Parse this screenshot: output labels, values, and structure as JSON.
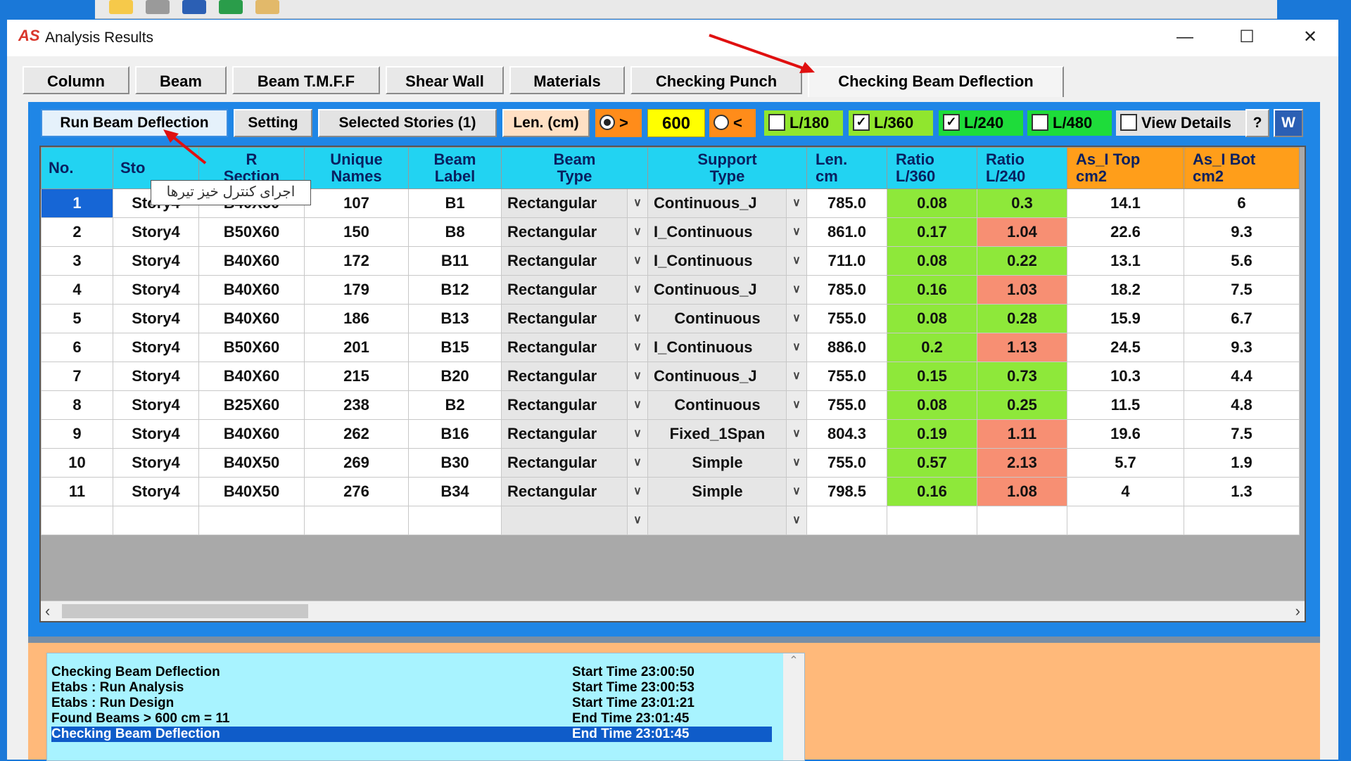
{
  "window": {
    "title": "Analysis Results",
    "app_icon": "AS"
  },
  "main_tabs": [
    "Column",
    "Beam",
    "Beam T.M.F.F",
    "Shear Wall",
    "Materials",
    "Checking Punch",
    "Checking Beam Deflection"
  ],
  "toolbar": {
    "run_label": "Run Beam Deflection",
    "setting_label": "Setting",
    "stories_label": "Selected Stories (1)",
    "len_label": "Len. (cm)",
    "gt_symbol": ">",
    "lt_symbol": "<",
    "len_value": "600",
    "chk_l180": "L/180",
    "chk_l360": "L/360",
    "chk_l240": "L/240",
    "chk_l480": "L/480",
    "view_details": "View Details",
    "help": "?",
    "word_icon": "W"
  },
  "tooltip": "اجرای کنترل خیز تیرها",
  "grid": {
    "headers": [
      "No.",
      "Story",
      "Section",
      "Unique Names",
      "Beam Label",
      "Beam Type",
      "Support Type",
      "Len. cm",
      "Ratio L/360",
      "Ratio L/240",
      "As_I Top cm2",
      "As_I Bot cm2"
    ],
    "header_lines": [
      [
        "No."
      ],
      [
        "Sto"
      ],
      [
        "R",
        "Section"
      ],
      [
        "Unique",
        "Names"
      ],
      [
        "Beam",
        "Label"
      ],
      [
        "Beam",
        "Type"
      ],
      [
        "Support",
        "Type"
      ],
      [
        "Len.",
        "cm"
      ],
      [
        "Ratio",
        "L/360"
      ],
      [
        "Ratio",
        "L/240"
      ],
      [
        "As_I Top",
        "cm2"
      ],
      [
        "As_I Bot",
        "cm2"
      ]
    ],
    "rows": [
      {
        "no": "1",
        "story": "Story4",
        "section": "B40X60",
        "unique": "107",
        "label": "B1",
        "type": "Rectangular",
        "support": "Continuous_J",
        "len": "785.0",
        "r360": "0.08",
        "r240": "0.3",
        "top": "14.1",
        "bot": "6",
        "r240_status": "ok"
      },
      {
        "no": "2",
        "story": "Story4",
        "section": "B50X60",
        "unique": "150",
        "label": "B8",
        "type": "Rectangular",
        "support": "I_Continuous",
        "len": "861.0",
        "r360": "0.17",
        "r240": "1.04",
        "top": "22.6",
        "bot": "9.3",
        "r240_status": "fail"
      },
      {
        "no": "3",
        "story": "Story4",
        "section": "B40X60",
        "unique": "172",
        "label": "B11",
        "type": "Rectangular",
        "support": "I_Continuous",
        "len": "711.0",
        "r360": "0.08",
        "r240": "0.22",
        "top": "13.1",
        "bot": "5.6",
        "r240_status": "ok"
      },
      {
        "no": "4",
        "story": "Story4",
        "section": "B40X60",
        "unique": "179",
        "label": "B12",
        "type": "Rectangular",
        "support": "Continuous_J",
        "len": "785.0",
        "r360": "0.16",
        "r240": "1.03",
        "top": "18.2",
        "bot": "7.5",
        "r240_status": "fail"
      },
      {
        "no": "5",
        "story": "Story4",
        "section": "B40X60",
        "unique": "186",
        "label": "B13",
        "type": "Rectangular",
        "support": "Continuous",
        "len": "755.0",
        "r360": "0.08",
        "r240": "0.28",
        "top": "15.9",
        "bot": "6.7",
        "r240_status": "ok"
      },
      {
        "no": "6",
        "story": "Story4",
        "section": "B50X60",
        "unique": "201",
        "label": "B15",
        "type": "Rectangular",
        "support": "I_Continuous",
        "len": "886.0",
        "r360": "0.2",
        "r240": "1.13",
        "top": "24.5",
        "bot": "9.3",
        "r240_status": "fail"
      },
      {
        "no": "7",
        "story": "Story4",
        "section": "B40X60",
        "unique": "215",
        "label": "B20",
        "type": "Rectangular",
        "support": "Continuous_J",
        "len": "755.0",
        "r360": "0.15",
        "r240": "0.73",
        "top": "10.3",
        "bot": "4.4",
        "r240_status": "ok"
      },
      {
        "no": "8",
        "story": "Story4",
        "section": "B25X60",
        "unique": "238",
        "label": "B2",
        "type": "Rectangular",
        "support": "Continuous",
        "len": "755.0",
        "r360": "0.08",
        "r240": "0.25",
        "top": "11.5",
        "bot": "4.8",
        "r240_status": "ok"
      },
      {
        "no": "9",
        "story": "Story4",
        "section": "B40X60",
        "unique": "262",
        "label": "B16",
        "type": "Rectangular",
        "support": "Fixed_1Span",
        "len": "804.3",
        "r360": "0.19",
        "r240": "1.11",
        "top": "19.6",
        "bot": "7.5",
        "r240_status": "fail"
      },
      {
        "no": "10",
        "story": "Story4",
        "section": "B40X50",
        "unique": "269",
        "label": "B30",
        "type": "Rectangular",
        "support": "Simple",
        "len": "755.0",
        "r360": "0.57",
        "r240": "2.13",
        "top": "5.7",
        "bot": "1.9",
        "r240_status": "fail"
      },
      {
        "no": "11",
        "story": "Story4",
        "section": "B40X50",
        "unique": "276",
        "label": "B34",
        "type": "Rectangular",
        "support": "Simple",
        "len": "798.5",
        "r360": "0.16",
        "r240": "1.08",
        "top": "4",
        "bot": "1.3",
        "r240_status": "fail"
      }
    ]
  },
  "log": [
    {
      "msg": "Checking Beam Deflection",
      "time": "Start Time 23:00:50"
    },
    {
      "msg": "Etabs : Run Analysis",
      "time": "Start Time 23:00:53"
    },
    {
      "msg": "Etabs : Run Design",
      "time": "Start Time 23:01:21"
    },
    {
      "msg": "Found Beams >  600 cm = 11",
      "time": "End  Time 23:01:45"
    },
    {
      "msg": "Checking Beam Deflection",
      "time": "End  Time 23:01:45"
    }
  ],
  "colors": {
    "ok": "#8ee83a",
    "fail": "#f78f73",
    "header": "#22d3f2",
    "header_orange": "#ff9e1a"
  }
}
